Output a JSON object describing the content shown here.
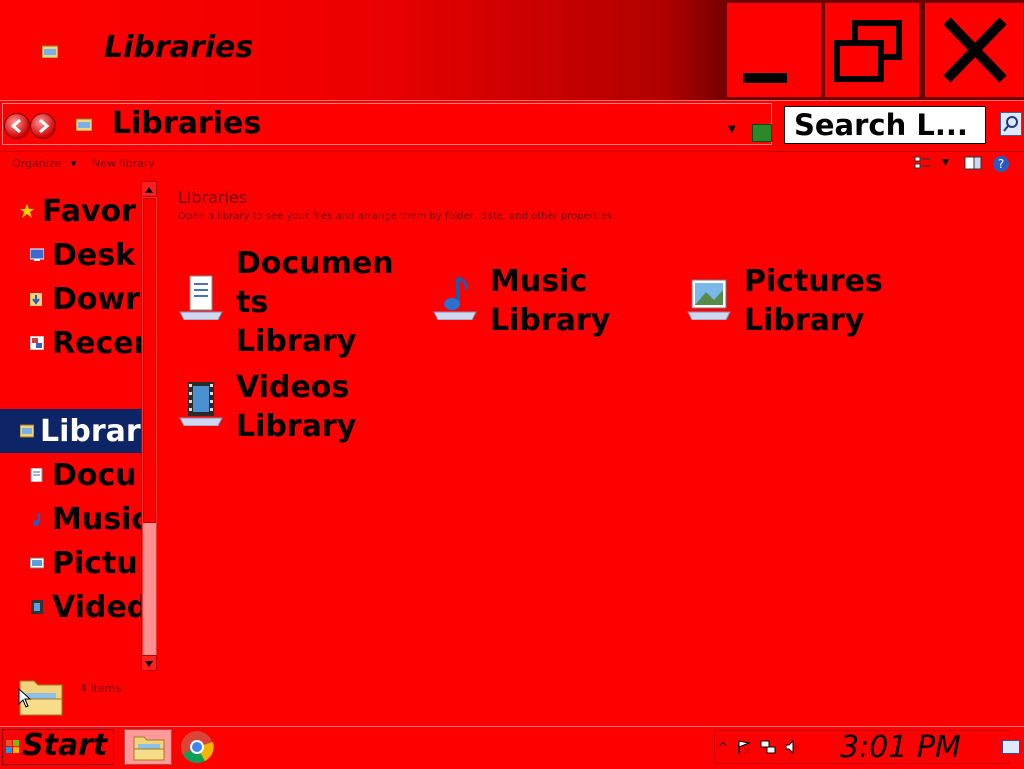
{
  "window": {
    "title": "Libraries",
    "controls": {
      "minimize": "minimize",
      "maximize": "maximize",
      "close": "close"
    }
  },
  "address_bar": {
    "path": "Libraries",
    "search_placeholder": "Search L..."
  },
  "toolbar": {
    "organize_label": "Organize",
    "organize_arrow": "▾",
    "new_library_label": "New library"
  },
  "nav_pane": {
    "favorites": {
      "label": "Favor",
      "items": [
        {
          "label": "Desk",
          "icon": "desktop-icon"
        },
        {
          "label": "Dowr",
          "icon": "downloads-icon"
        },
        {
          "label": "Recer",
          "icon": "recent-places-icon"
        }
      ]
    },
    "libraries": {
      "label": "Librar",
      "selected": true,
      "items": [
        {
          "label": "Docu",
          "icon": "documents-icon"
        },
        {
          "label": "Music",
          "icon": "music-icon"
        },
        {
          "label": "Pictu",
          "icon": "pictures-icon"
        },
        {
          "label": "Vided",
          "icon": "videos-icon"
        }
      ]
    }
  },
  "content": {
    "title": "Libraries",
    "description": "Open a library to see your files and arrange them by folder, date, and other properties.",
    "libraries": [
      {
        "line1": "Documen",
        "line2": "ts",
        "line3": "Library",
        "icon": "documents-library-icon"
      },
      {
        "line1": "Music",
        "line2": "Library",
        "icon": "music-library-icon"
      },
      {
        "line1": "Pictures",
        "line2": "Library",
        "icon": "pictures-library-icon"
      },
      {
        "line1": "Videos",
        "line2": "Library",
        "icon": "videos-library-icon"
      }
    ]
  },
  "status_bar": {
    "item_count": "4 items"
  },
  "taskbar": {
    "start_label": "Start",
    "clock": "3:01 PM",
    "tray_arrow": "^"
  },
  "colors": {
    "background": "#ff0000",
    "selection": "#0d2466",
    "text": "#000000",
    "muted_text": "#7a0000"
  }
}
